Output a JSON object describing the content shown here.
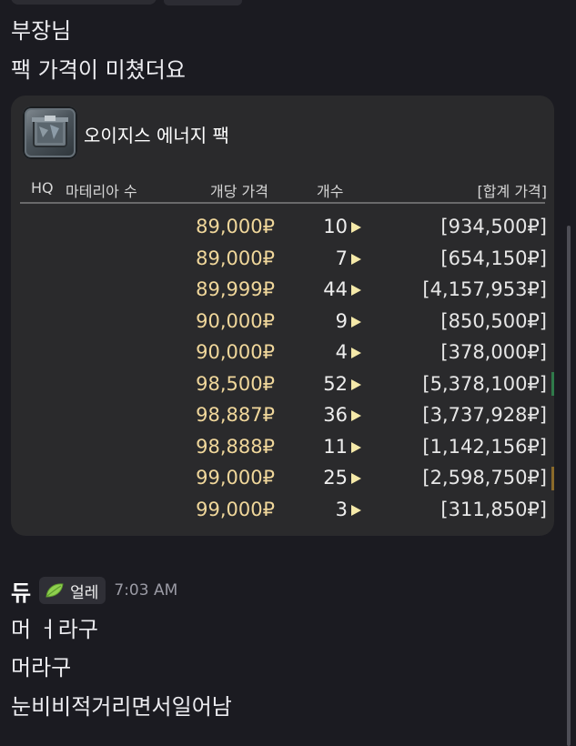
{
  "previous_message": {
    "lines": [
      "부장님",
      "팩 가격이 미쳤더요"
    ]
  },
  "embed": {
    "item_name": "오이지스 에너지 팩",
    "icon": "energy-pack-crate-icon",
    "columns": {
      "hq": "HQ",
      "materia": "마테리아 수",
      "unit_price": "개당 가격",
      "quantity": "개수",
      "total": "[합계 가격]"
    },
    "listings": [
      {
        "unit_price": "89,000₽",
        "quantity": "10",
        "total": "[934,500₽]"
      },
      {
        "unit_price": "89,000₽",
        "quantity": "7",
        "total": "[654,150₽]"
      },
      {
        "unit_price": "89,999₽",
        "quantity": "44",
        "total": "[4,157,953₽]"
      },
      {
        "unit_price": "90,000₽",
        "quantity": "9",
        "total": "[850,500₽]"
      },
      {
        "unit_price": "90,000₽",
        "quantity": "4",
        "total": "[378,000₽]"
      },
      {
        "unit_price": "98,500₽",
        "quantity": "52",
        "total": "[5,378,100₽]"
      },
      {
        "unit_price": "98,887₽",
        "quantity": "36",
        "total": "[3,737,928₽]"
      },
      {
        "unit_price": "98,888₽",
        "quantity": "11",
        "total": "[1,142,156₽]"
      },
      {
        "unit_price": "99,000₽",
        "quantity": "25",
        "total": "[2,598,750₽]"
      },
      {
        "unit_price": "99,000₽",
        "quantity": "3",
        "total": "[311,850₽]"
      }
    ]
  },
  "message": {
    "author": "듀",
    "role_icon": "leaf-icon",
    "role": "얼레",
    "timestamp": "7:03 AM",
    "lines": [
      "머 ㅓ라구",
      "머라구",
      "눈비비적거리면서일어남"
    ]
  },
  "colors": {
    "background": "#1b1b21",
    "embed_background": "#2a2a2c",
    "price_text": "#f0d79b",
    "arrow": "#f5e9a9",
    "role_leaf": "#8fd14f"
  }
}
